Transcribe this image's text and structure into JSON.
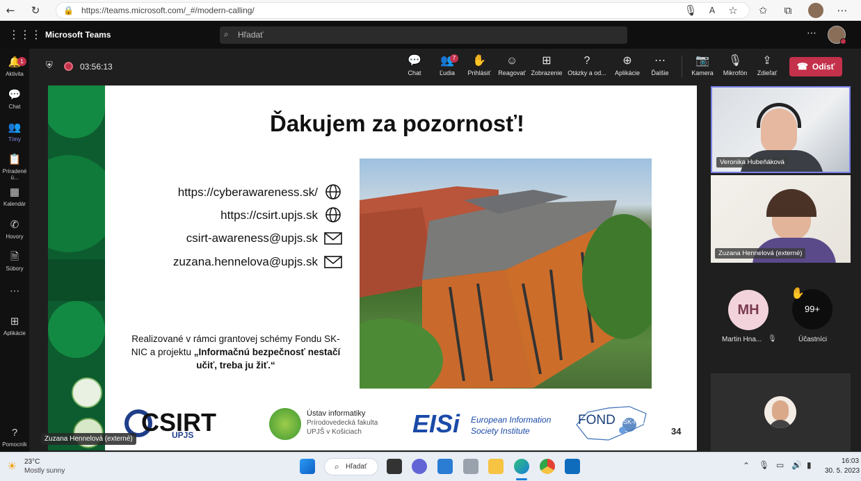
{
  "browser": {
    "url": "https://teams.microsoft.com/_#/modern-calling/"
  },
  "teams": {
    "app_title": "Microsoft Teams",
    "search_placeholder": "Hľadať",
    "rail": [
      {
        "label": "Aktivita",
        "icon": "bell-icon",
        "badge": "1"
      },
      {
        "label": "Chat",
        "icon": "chat-icon"
      },
      {
        "label": "Tímy",
        "icon": "teams-icon"
      },
      {
        "label": "Priradené ú...",
        "icon": "assignments-icon"
      },
      {
        "label": "Kalendár",
        "icon": "calendar-icon"
      },
      {
        "label": "Hovory",
        "icon": "phone-icon"
      },
      {
        "label": "Súbory",
        "icon": "files-icon"
      },
      {
        "label": "Aplikácie",
        "icon": "apps-icon"
      },
      {
        "label": "Pomocník",
        "icon": "help-icon"
      }
    ],
    "accent": "#7b83eb"
  },
  "meeting": {
    "timer": "03:56:13",
    "controls": [
      {
        "label": "Chat",
        "icon": "chat-icon"
      },
      {
        "label": "Ľudia",
        "icon": "people-icon",
        "badge": "7"
      },
      {
        "label": "Prihlásiť",
        "icon": "raise-hand-icon"
      },
      {
        "label": "Reagovať",
        "icon": "emoji-icon"
      },
      {
        "label": "Zobrazenie",
        "icon": "view-icon"
      },
      {
        "label": "Otázky a od...",
        "icon": "qa-icon"
      },
      {
        "label": "Aplikácie",
        "icon": "add-app-icon"
      },
      {
        "label": "Ďalšie",
        "icon": "more-icon"
      },
      {
        "label": "Kamera",
        "icon": "camera-off-icon"
      },
      {
        "label": "Mikrofón",
        "icon": "mic-off-icon"
      },
      {
        "label": "Zdieľať",
        "icon": "share-icon"
      }
    ],
    "leave_label": "Odísť",
    "leave_color": "#c4314b",
    "presenter_tag": "Zuzana Hennelová (externé)"
  },
  "slide": {
    "title": "Ďakujem za pozornosť!",
    "links": [
      {
        "text": "https://cyberawareness.sk/",
        "icon": "globe-icon"
      },
      {
        "text": "https://csirt.upjs.sk",
        "icon": "globe-icon"
      },
      {
        "text": "csirt-awareness@upjs.sk",
        "icon": "mail-icon"
      },
      {
        "text": "zuzana.hennelova@upjs.sk",
        "icon": "mail-icon"
      }
    ],
    "grant_normal": "Realizované v rámci grantovej schémy Fondu SK-NIC a projektu ",
    "grant_bold": "„Informačnú bezpečnosť nestačí učiť, treba ju žiť.“",
    "logos": {
      "csirt": "CSIRT",
      "csirt_sub": "UPJS",
      "ustav_line1": "Ústav informatiky",
      "ustav_line2": "Prírodovedecká fakulta",
      "ustav_line3": "UPJŠ v Košiciach",
      "eisi": "EISi",
      "eisi_line1": "European Information",
      "eisi_line2": "Society Institute",
      "fond": "FOND",
      "fond_sub": "SK-NIC"
    },
    "page_number": "34"
  },
  "participants": [
    {
      "name": "Veronika Hubeňáková"
    },
    {
      "name": "Zuzana Hennelová (externé)"
    }
  ],
  "avatars": {
    "mh_initials": "MH",
    "mh_name": "Martin Hna...",
    "count": "99+",
    "count_label": "Účastníci"
  },
  "taskbar": {
    "temperature": "23°C",
    "weather": "Mostly sunny",
    "search_label": "Hľadať",
    "time": "16:03",
    "date": "30. 5. 2023"
  }
}
